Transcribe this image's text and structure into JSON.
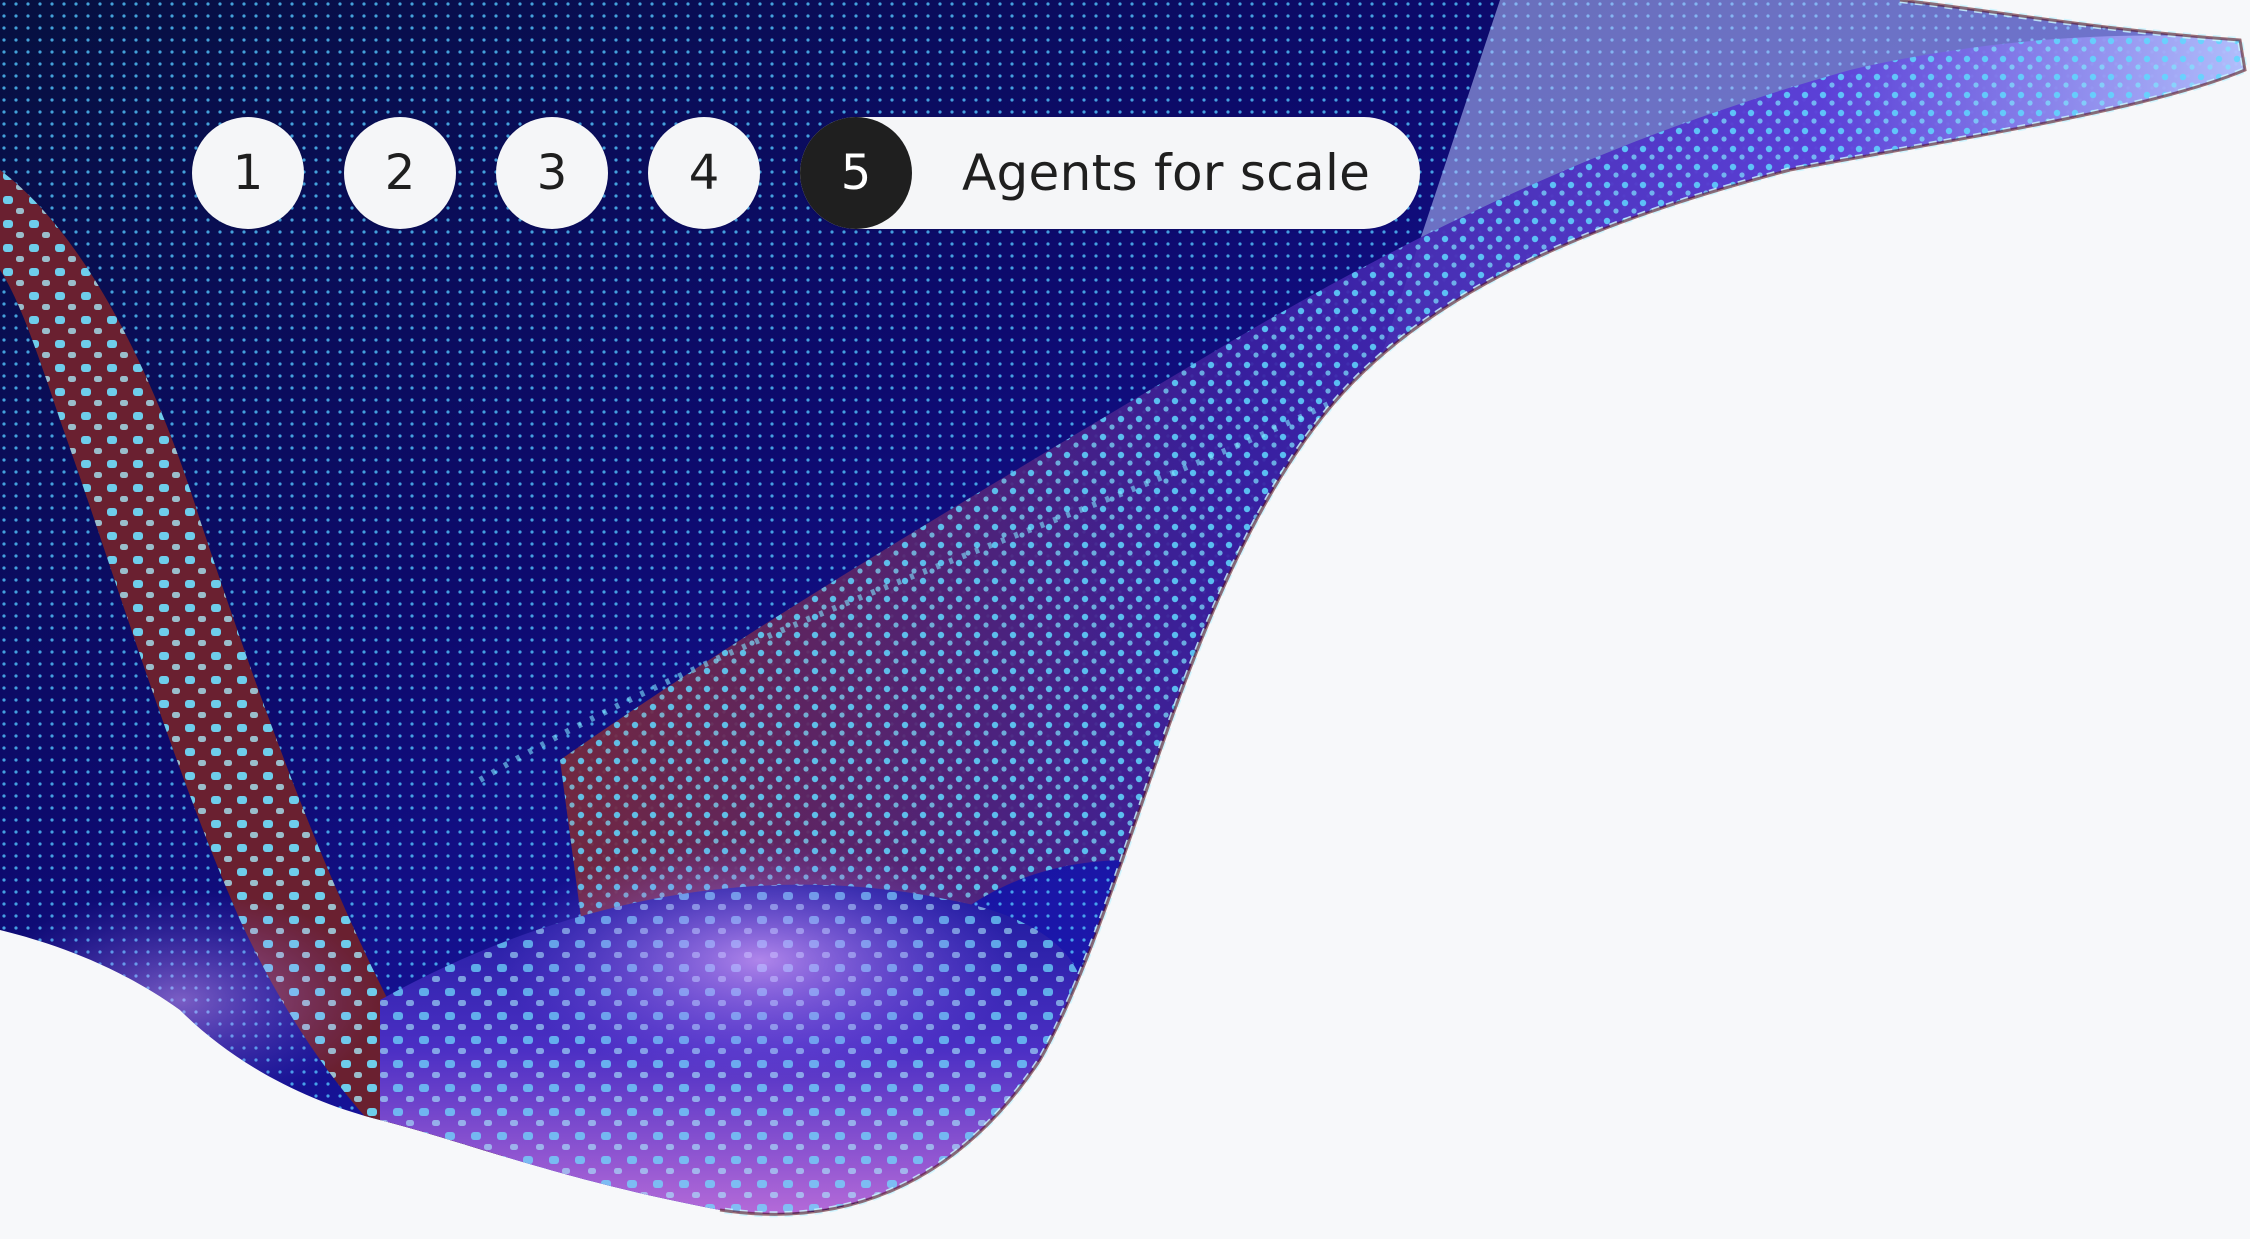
{
  "steps": {
    "items": [
      "1",
      "2",
      "3",
      "4"
    ],
    "active_number": "5",
    "active_label": "Agents for scale"
  },
  "colors": {
    "page_background": "#f7f8fa",
    "pill_background": "#f5f6f8",
    "active_pill": "#1f1f1f",
    "text": "#1f1f1f",
    "art_deep_blue": "#0d0a6e",
    "art_cyan": "#5fd8ff",
    "art_violet": "#8a5cf0",
    "art_maroon": "#5a1420"
  },
  "icons": {
    "hero": "abstract-wave-art"
  }
}
